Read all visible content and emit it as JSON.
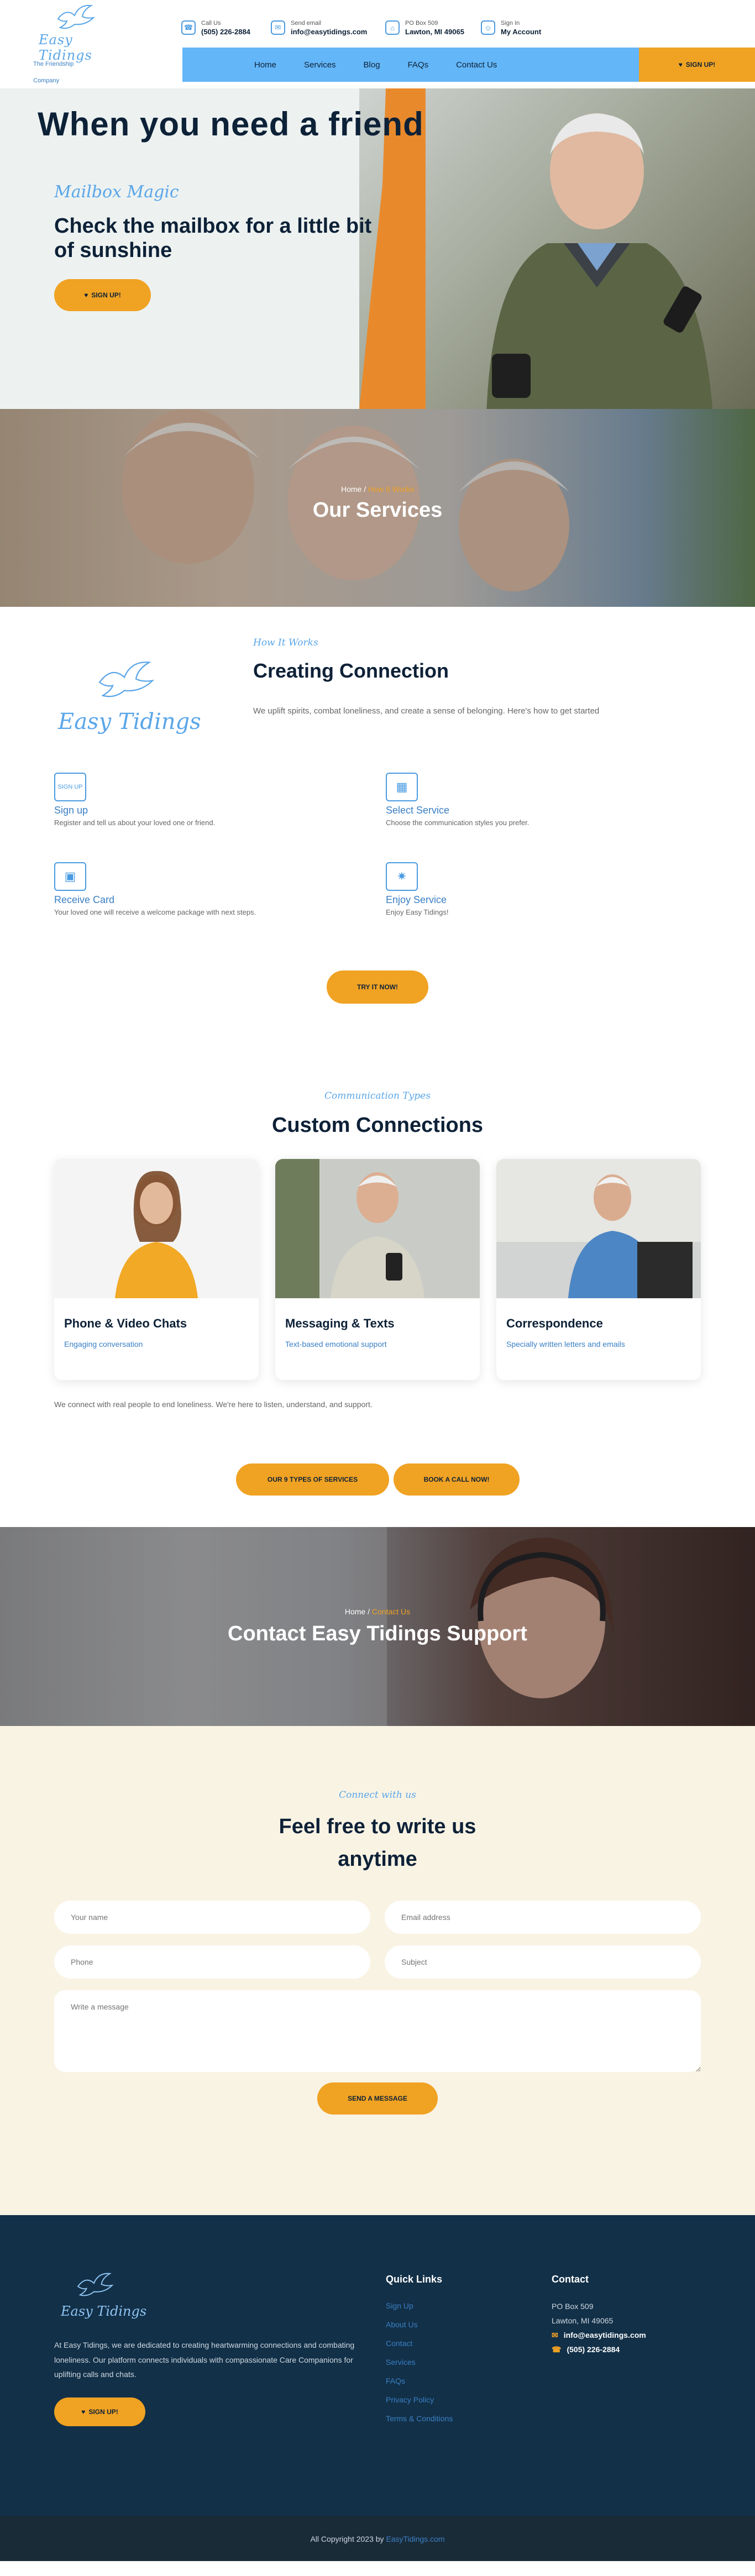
{
  "header": {
    "logo_wordmark": "Easy Tidings",
    "logo_tagline_1": "The Friendship",
    "logo_tagline_2": "Company",
    "contacts": [
      {
        "icon": "phone-icon",
        "label": "Call Us",
        "value": "(505) 226-2884"
      },
      {
        "icon": "mail-icon",
        "label": "Send email",
        "value": "info@easytidings.com"
      },
      {
        "icon": "map-icon",
        "label": "PO Box 509",
        "value": "Lawton, MI 49065"
      },
      {
        "icon": "user-icon",
        "label": "Sign In",
        "value": "My Account"
      }
    ],
    "nav": [
      "Home",
      "Services",
      "Blog",
      "FAQs",
      "Contact Us"
    ],
    "cta": "SIGN UP!",
    "accent": "#63b6f8",
    "cta_color": "#f0a223"
  },
  "hero": {
    "title": "When you need a friend",
    "script": "Mailbox Magic",
    "headline": "Check the mailbox for a little bit of sunshine",
    "cta": "SIGN UP!"
  },
  "services_banner": {
    "crumb_home": "Home",
    "crumb_sep": "/",
    "crumb_current": "How It Works",
    "title": "Our Services"
  },
  "how": {
    "script": "How It Works",
    "title": "Creating Connection",
    "desc": "We uplift spirits, combat loneliness, and create a sense of belonging. Here's how to get started",
    "logo_wordmark": "Easy Tidings",
    "steps": [
      {
        "icon": "signup-icon",
        "icon_text": "SIGN UP",
        "title": "Sign up",
        "text": "Register and tell us about your loved one or friend."
      },
      {
        "icon": "service-grid-icon",
        "title": "Select Service",
        "text": "Choose the communication styles you prefer."
      },
      {
        "icon": "package-icon",
        "title": "Receive Card",
        "text": "Your loved one will receive a welcome package with next steps."
      },
      {
        "icon": "celebrate-icon",
        "title": "Enjoy Service",
        "text": "Enjoy Easy Tidings!"
      }
    ],
    "cta": "TRY IT NOW!"
  },
  "connections": {
    "script": "Communication Types",
    "title": "Custom Connections",
    "cards": [
      {
        "title": "Phone & Video Chats",
        "sub": "Engaging conversation"
      },
      {
        "title": "Messaging & Texts",
        "sub": "Text-based emotional support"
      },
      {
        "title": "Correspondence",
        "sub": "Specially written letters and emails"
      }
    ],
    "note": "We connect with real people to end loneliness. We're here to listen, understand, and support.",
    "btn1": "OUR 9 TYPES OF SERVICES",
    "btn2": "BOOK A CALL NOW!"
  },
  "contact_banner": {
    "crumb_home": "Home",
    "crumb_sep": "/",
    "crumb_current": "Contact Us",
    "title": "Contact Easy Tidings Support"
  },
  "form": {
    "script": "Connect with us",
    "title_line1": "Feel free to write us",
    "title_line2": "anytime",
    "name_ph": "Your name",
    "email_ph": "Email address",
    "phone_ph": "Phone",
    "subject_ph": "Subject",
    "message_ph": "Write a message",
    "send": "SEND A MESSAGE"
  },
  "footer": {
    "logo_wordmark": "Easy Tidings",
    "blurb": "At Easy Tidings, we are dedicated to creating heartwarming connections and combating loneliness. Our platform connects individuals with compassionate Care Companions for uplifting calls and chats.",
    "cta": "SIGN UP!",
    "quick_links_title": "Quick Links",
    "quick_links": [
      "Sign Up",
      "About Us",
      "Contact",
      "Services",
      "FAQs",
      "Privacy Policy",
      "Terms & Conditions"
    ],
    "contact_title": "Contact",
    "address_1": "PO Box 509",
    "address_2": "Lawton, MI 49065",
    "email": "info@easytidings.com",
    "phone": "(505) 226-2884"
  },
  "copyright": {
    "text": "All Copyright 2023 by",
    "link": "EasyTidings.com"
  }
}
